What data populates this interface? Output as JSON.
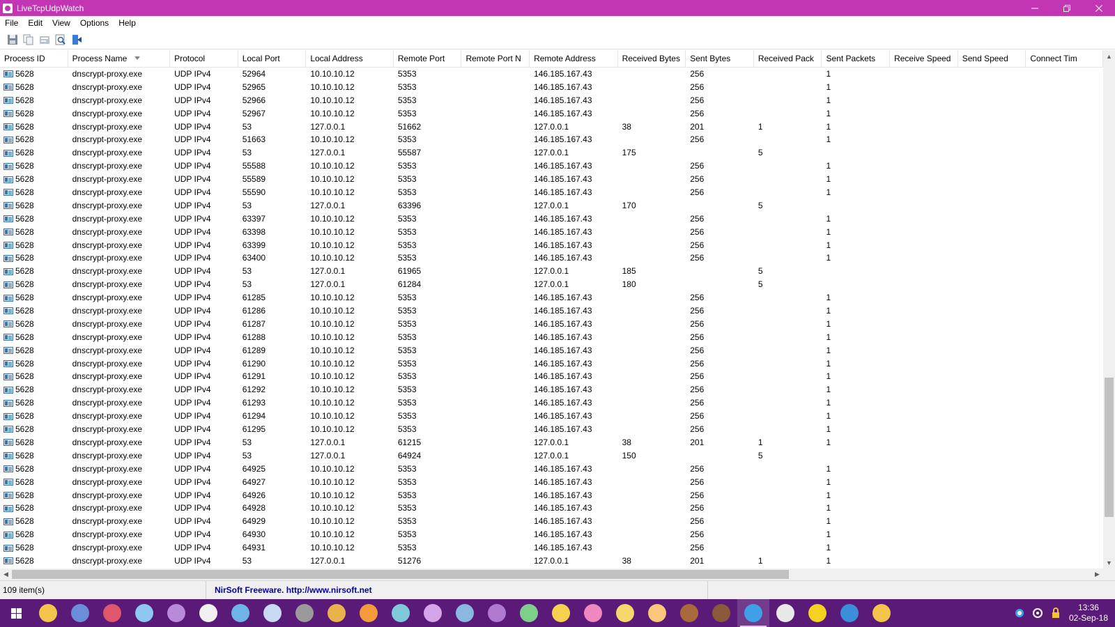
{
  "window": {
    "title": "LiveTcpUdpWatch",
    "minimize_icon": "minimize-icon",
    "restore_icon": "restore-icon",
    "close_icon": "close-icon"
  },
  "menu": [
    "File",
    "Edit",
    "View",
    "Options",
    "Help"
  ],
  "toolbar": {
    "buttons": [
      "save-icon",
      "copy-icon",
      "properties-icon",
      "find-icon",
      "exit-icon"
    ]
  },
  "columns": [
    {
      "label": "Process ID",
      "key": "pid"
    },
    {
      "label": "Process Name",
      "key": "name"
    },
    {
      "label": "Protocol",
      "key": "proto"
    },
    {
      "label": "Local Port",
      "key": "lport"
    },
    {
      "label": "Local Address",
      "key": "laddr"
    },
    {
      "label": "Remote Port",
      "key": "rport"
    },
    {
      "label": "Remote Port N",
      "key": "rportn"
    },
    {
      "label": "Remote Address",
      "key": "raddr"
    },
    {
      "label": "Received Bytes",
      "key": "rbytes"
    },
    {
      "label": "Sent Bytes",
      "key": "sbytes"
    },
    {
      "label": "Received Pack",
      "key": "rpack"
    },
    {
      "label": "Sent Packets",
      "key": "spack"
    },
    {
      "label": "Receive Speed",
      "key": "rspeed"
    },
    {
      "label": "Send Speed",
      "key": "sspeed"
    },
    {
      "label": "Connect Tim",
      "key": "ctime"
    }
  ],
  "sorted_column": "Process Name",
  "rows": [
    [
      "5628",
      "dnscrypt-proxy.exe",
      "UDP IPv4",
      "52964",
      "10.10.10.12",
      "5353",
      "",
      "146.185.167.43",
      "",
      "256",
      "",
      "1",
      "",
      "",
      ""
    ],
    [
      "5628",
      "dnscrypt-proxy.exe",
      "UDP IPv4",
      "52965",
      "10.10.10.12",
      "5353",
      "",
      "146.185.167.43",
      "",
      "256",
      "",
      "1",
      "",
      "",
      ""
    ],
    [
      "5628",
      "dnscrypt-proxy.exe",
      "UDP IPv4",
      "52966",
      "10.10.10.12",
      "5353",
      "",
      "146.185.167.43",
      "",
      "256",
      "",
      "1",
      "",
      "",
      ""
    ],
    [
      "5628",
      "dnscrypt-proxy.exe",
      "UDP IPv4",
      "52967",
      "10.10.10.12",
      "5353",
      "",
      "146.185.167.43",
      "",
      "256",
      "",
      "1",
      "",
      "",
      ""
    ],
    [
      "5628",
      "dnscrypt-proxy.exe",
      "UDP IPv4",
      "53",
      "127.0.0.1",
      "51662",
      "",
      "127.0.0.1",
      "38",
      "201",
      "1",
      "1",
      "",
      "",
      ""
    ],
    [
      "5628",
      "dnscrypt-proxy.exe",
      "UDP IPv4",
      "51663",
      "10.10.10.12",
      "5353",
      "",
      "146.185.167.43",
      "",
      "256",
      "",
      "1",
      "",
      "",
      ""
    ],
    [
      "5628",
      "dnscrypt-proxy.exe",
      "UDP IPv4",
      "53",
      "127.0.0.1",
      "55587",
      "",
      "127.0.0.1",
      "175",
      "",
      "5",
      "",
      "",
      "",
      ""
    ],
    [
      "5628",
      "dnscrypt-proxy.exe",
      "UDP IPv4",
      "55588",
      "10.10.10.12",
      "5353",
      "",
      "146.185.167.43",
      "",
      "256",
      "",
      "1",
      "",
      "",
      ""
    ],
    [
      "5628",
      "dnscrypt-proxy.exe",
      "UDP IPv4",
      "55589",
      "10.10.10.12",
      "5353",
      "",
      "146.185.167.43",
      "",
      "256",
      "",
      "1",
      "",
      "",
      ""
    ],
    [
      "5628",
      "dnscrypt-proxy.exe",
      "UDP IPv4",
      "55590",
      "10.10.10.12",
      "5353",
      "",
      "146.185.167.43",
      "",
      "256",
      "",
      "1",
      "",
      "",
      ""
    ],
    [
      "5628",
      "dnscrypt-proxy.exe",
      "UDP IPv4",
      "53",
      "127.0.0.1",
      "63396",
      "",
      "127.0.0.1",
      "170",
      "",
      "5",
      "",
      "",
      "",
      ""
    ],
    [
      "5628",
      "dnscrypt-proxy.exe",
      "UDP IPv4",
      "63397",
      "10.10.10.12",
      "5353",
      "",
      "146.185.167.43",
      "",
      "256",
      "",
      "1",
      "",
      "",
      ""
    ],
    [
      "5628",
      "dnscrypt-proxy.exe",
      "UDP IPv4",
      "63398",
      "10.10.10.12",
      "5353",
      "",
      "146.185.167.43",
      "",
      "256",
      "",
      "1",
      "",
      "",
      ""
    ],
    [
      "5628",
      "dnscrypt-proxy.exe",
      "UDP IPv4",
      "63399",
      "10.10.10.12",
      "5353",
      "",
      "146.185.167.43",
      "",
      "256",
      "",
      "1",
      "",
      "",
      ""
    ],
    [
      "5628",
      "dnscrypt-proxy.exe",
      "UDP IPv4",
      "63400",
      "10.10.10.12",
      "5353",
      "",
      "146.185.167.43",
      "",
      "256",
      "",
      "1",
      "",
      "",
      ""
    ],
    [
      "5628",
      "dnscrypt-proxy.exe",
      "UDP IPv4",
      "53",
      "127.0.0.1",
      "61965",
      "",
      "127.0.0.1",
      "185",
      "",
      "5",
      "",
      "",
      "",
      ""
    ],
    [
      "5628",
      "dnscrypt-proxy.exe",
      "UDP IPv4",
      "53",
      "127.0.0.1",
      "61284",
      "",
      "127.0.0.1",
      "180",
      "",
      "5",
      "",
      "",
      "",
      ""
    ],
    [
      "5628",
      "dnscrypt-proxy.exe",
      "UDP IPv4",
      "61285",
      "10.10.10.12",
      "5353",
      "",
      "146.185.167.43",
      "",
      "256",
      "",
      "1",
      "",
      "",
      ""
    ],
    [
      "5628",
      "dnscrypt-proxy.exe",
      "UDP IPv4",
      "61286",
      "10.10.10.12",
      "5353",
      "",
      "146.185.167.43",
      "",
      "256",
      "",
      "1",
      "",
      "",
      ""
    ],
    [
      "5628",
      "dnscrypt-proxy.exe",
      "UDP IPv4",
      "61287",
      "10.10.10.12",
      "5353",
      "",
      "146.185.167.43",
      "",
      "256",
      "",
      "1",
      "",
      "",
      ""
    ],
    [
      "5628",
      "dnscrypt-proxy.exe",
      "UDP IPv4",
      "61288",
      "10.10.10.12",
      "5353",
      "",
      "146.185.167.43",
      "",
      "256",
      "",
      "1",
      "",
      "",
      ""
    ],
    [
      "5628",
      "dnscrypt-proxy.exe",
      "UDP IPv4",
      "61289",
      "10.10.10.12",
      "5353",
      "",
      "146.185.167.43",
      "",
      "256",
      "",
      "1",
      "",
      "",
      ""
    ],
    [
      "5628",
      "dnscrypt-proxy.exe",
      "UDP IPv4",
      "61290",
      "10.10.10.12",
      "5353",
      "",
      "146.185.167.43",
      "",
      "256",
      "",
      "1",
      "",
      "",
      ""
    ],
    [
      "5628",
      "dnscrypt-proxy.exe",
      "UDP IPv4",
      "61291",
      "10.10.10.12",
      "5353",
      "",
      "146.185.167.43",
      "",
      "256",
      "",
      "1",
      "",
      "",
      ""
    ],
    [
      "5628",
      "dnscrypt-proxy.exe",
      "UDP IPv4",
      "61292",
      "10.10.10.12",
      "5353",
      "",
      "146.185.167.43",
      "",
      "256",
      "",
      "1",
      "",
      "",
      ""
    ],
    [
      "5628",
      "dnscrypt-proxy.exe",
      "UDP IPv4",
      "61293",
      "10.10.10.12",
      "5353",
      "",
      "146.185.167.43",
      "",
      "256",
      "",
      "1",
      "",
      "",
      ""
    ],
    [
      "5628",
      "dnscrypt-proxy.exe",
      "UDP IPv4",
      "61294",
      "10.10.10.12",
      "5353",
      "",
      "146.185.167.43",
      "",
      "256",
      "",
      "1",
      "",
      "",
      ""
    ],
    [
      "5628",
      "dnscrypt-proxy.exe",
      "UDP IPv4",
      "61295",
      "10.10.10.12",
      "5353",
      "",
      "146.185.167.43",
      "",
      "256",
      "",
      "1",
      "",
      "",
      ""
    ],
    [
      "5628",
      "dnscrypt-proxy.exe",
      "UDP IPv4",
      "53",
      "127.0.0.1",
      "61215",
      "",
      "127.0.0.1",
      "38",
      "201",
      "1",
      "1",
      "",
      "",
      ""
    ],
    [
      "5628",
      "dnscrypt-proxy.exe",
      "UDP IPv4",
      "53",
      "127.0.0.1",
      "64924",
      "",
      "127.0.0.1",
      "150",
      "",
      "5",
      "",
      "",
      "",
      ""
    ],
    [
      "5628",
      "dnscrypt-proxy.exe",
      "UDP IPv4",
      "64925",
      "10.10.10.12",
      "5353",
      "",
      "146.185.167.43",
      "",
      "256",
      "",
      "1",
      "",
      "",
      ""
    ],
    [
      "5628",
      "dnscrypt-proxy.exe",
      "UDP IPv4",
      "64927",
      "10.10.10.12",
      "5353",
      "",
      "146.185.167.43",
      "",
      "256",
      "",
      "1",
      "",
      "",
      ""
    ],
    [
      "5628",
      "dnscrypt-proxy.exe",
      "UDP IPv4",
      "64926",
      "10.10.10.12",
      "5353",
      "",
      "146.185.167.43",
      "",
      "256",
      "",
      "1",
      "",
      "",
      ""
    ],
    [
      "5628",
      "dnscrypt-proxy.exe",
      "UDP IPv4",
      "64928",
      "10.10.10.12",
      "5353",
      "",
      "146.185.167.43",
      "",
      "256",
      "",
      "1",
      "",
      "",
      ""
    ],
    [
      "5628",
      "dnscrypt-proxy.exe",
      "UDP IPv4",
      "64929",
      "10.10.10.12",
      "5353",
      "",
      "146.185.167.43",
      "",
      "256",
      "",
      "1",
      "",
      "",
      ""
    ],
    [
      "5628",
      "dnscrypt-proxy.exe",
      "UDP IPv4",
      "64930",
      "10.10.10.12",
      "5353",
      "",
      "146.185.167.43",
      "",
      "256",
      "",
      "1",
      "",
      "",
      ""
    ],
    [
      "5628",
      "dnscrypt-proxy.exe",
      "UDP IPv4",
      "64931",
      "10.10.10.12",
      "5353",
      "",
      "146.185.167.43",
      "",
      "256",
      "",
      "1",
      "",
      "",
      ""
    ],
    [
      "5628",
      "dnscrypt-proxy.exe",
      "UDP IPv4",
      "53",
      "127.0.0.1",
      "51276",
      "",
      "127.0.0.1",
      "38",
      "201",
      "1",
      "1",
      "",
      "",
      ""
    ]
  ],
  "status": {
    "count": "109 item(s)",
    "credit": "NirSoft Freeware.  http://www.nirsoft.net"
  },
  "taskbar": {
    "apps": [
      "pony-app-1",
      "folder-app",
      "pony-app-2",
      "pony-app-3",
      "pony-app-4",
      "pony-app-5",
      "pony-app-6",
      "pony-app-7",
      "pony-app-8",
      "pony-app-9",
      "pony-app-10",
      "pony-app-11",
      "pony-app-12",
      "pony-app-13",
      "pony-app-14",
      "pony-app-15",
      "pony-app-16",
      "pony-app-17",
      "pony-app-18",
      "pony-app-19",
      "pony-app-20",
      "pony-app-21",
      "pony-app-22",
      "pony-app-23",
      "browser-app",
      "power-app",
      "network-app"
    ],
    "active_index": 22,
    "time": "13:36",
    "date": "02-Sep-18"
  },
  "colors": {
    "titlebar": "#c236b4",
    "taskbar": "#5a1a78",
    "credit_text": "#0000aa"
  }
}
